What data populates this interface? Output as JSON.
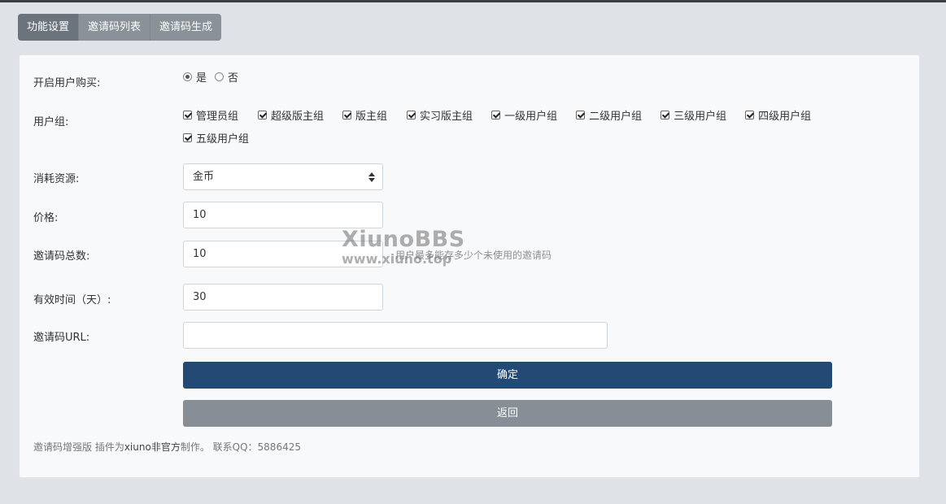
{
  "tabs": [
    "功能设置",
    "邀请码列表",
    "邀请码生成"
  ],
  "form": {
    "purchase_label": "开启用户购买:",
    "purchase_options": [
      "是",
      "否"
    ],
    "groups_label": "用户组:",
    "groups": [
      "管理员组",
      "超级版主组",
      "版主组",
      "实习版主组",
      "一级用户组",
      "二级用户组",
      "三级用户组",
      "四级用户组",
      "五级用户组"
    ],
    "resource_label": "消耗资源:",
    "resource_value": "金币",
    "price_label": "价格:",
    "price_value": "10",
    "total_label": "邀请码总数:",
    "total_value": "10",
    "total_help": "用户最多能存多少个未使用的邀请码",
    "valid_label": "有效时间（天）:",
    "valid_value": "30",
    "url_label": "邀请码URL:",
    "url_value": "",
    "confirm_label": "确定",
    "back_label": "返回"
  },
  "footer": {
    "prefix": "邀请码增强版 插件为",
    "link": "xiuno非官方",
    "suffix": "制作。 联系QQ：5886425"
  },
  "watermark": {
    "title": "XiunoBBS",
    "sub": "www.xiuno.top"
  },
  "colors": {
    "primary": "#234a75",
    "secondary": "#878e96",
    "tab_active": "#6b737c",
    "tab": "#8a9199"
  }
}
